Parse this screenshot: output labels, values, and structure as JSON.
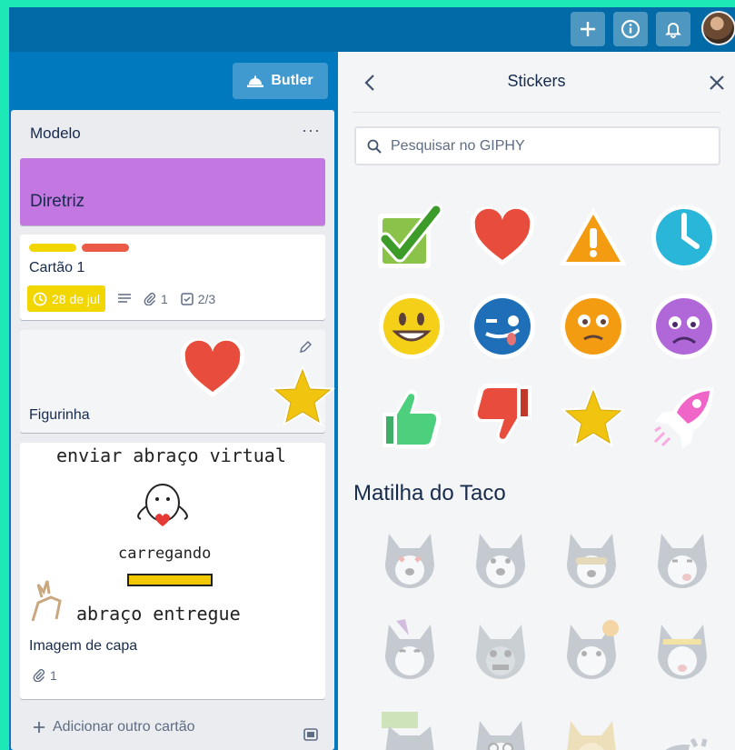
{
  "topbar": {
    "add_icon": "plus-icon",
    "info_icon": "info-icon",
    "bell_icon": "bell-icon"
  },
  "butler": {
    "label": "Butler",
    "icon": "butler-bell-icon"
  },
  "list": {
    "title": "Modelo",
    "menu": "···",
    "cards": {
      "diretriz": {
        "title": "Diretriz",
        "cover_color": "#c377e0"
      },
      "cartao1": {
        "title": "Cartão 1",
        "labels": [
          "#f2d600",
          "#eb5a46"
        ],
        "due": "28 de jul",
        "attachments": "1",
        "checklist": "2/3"
      },
      "figurinha": {
        "title": "Figurinha"
      },
      "capa": {
        "cover_line1": "enviar abraço virtual",
        "cover_line2": "carregando",
        "cover_line3": "abraço entregue",
        "title": "Imagem de capa",
        "attachments": "1"
      }
    },
    "add_card": "Adicionar outro cartão"
  },
  "panel": {
    "title": "Stickers",
    "search_placeholder": "Pesquisar no GIPHY",
    "stickers": [
      "check-sticker",
      "heart-sticker",
      "warning-sticker",
      "clock-sticker",
      "smile-sticker",
      "wink-tongue-sticker",
      "confused-sticker",
      "worried-sticker",
      "thumbs-up-sticker",
      "thumbs-down-sticker",
      "star-sticker",
      "rocket-sticker"
    ],
    "section": "Matilha do Taco"
  }
}
